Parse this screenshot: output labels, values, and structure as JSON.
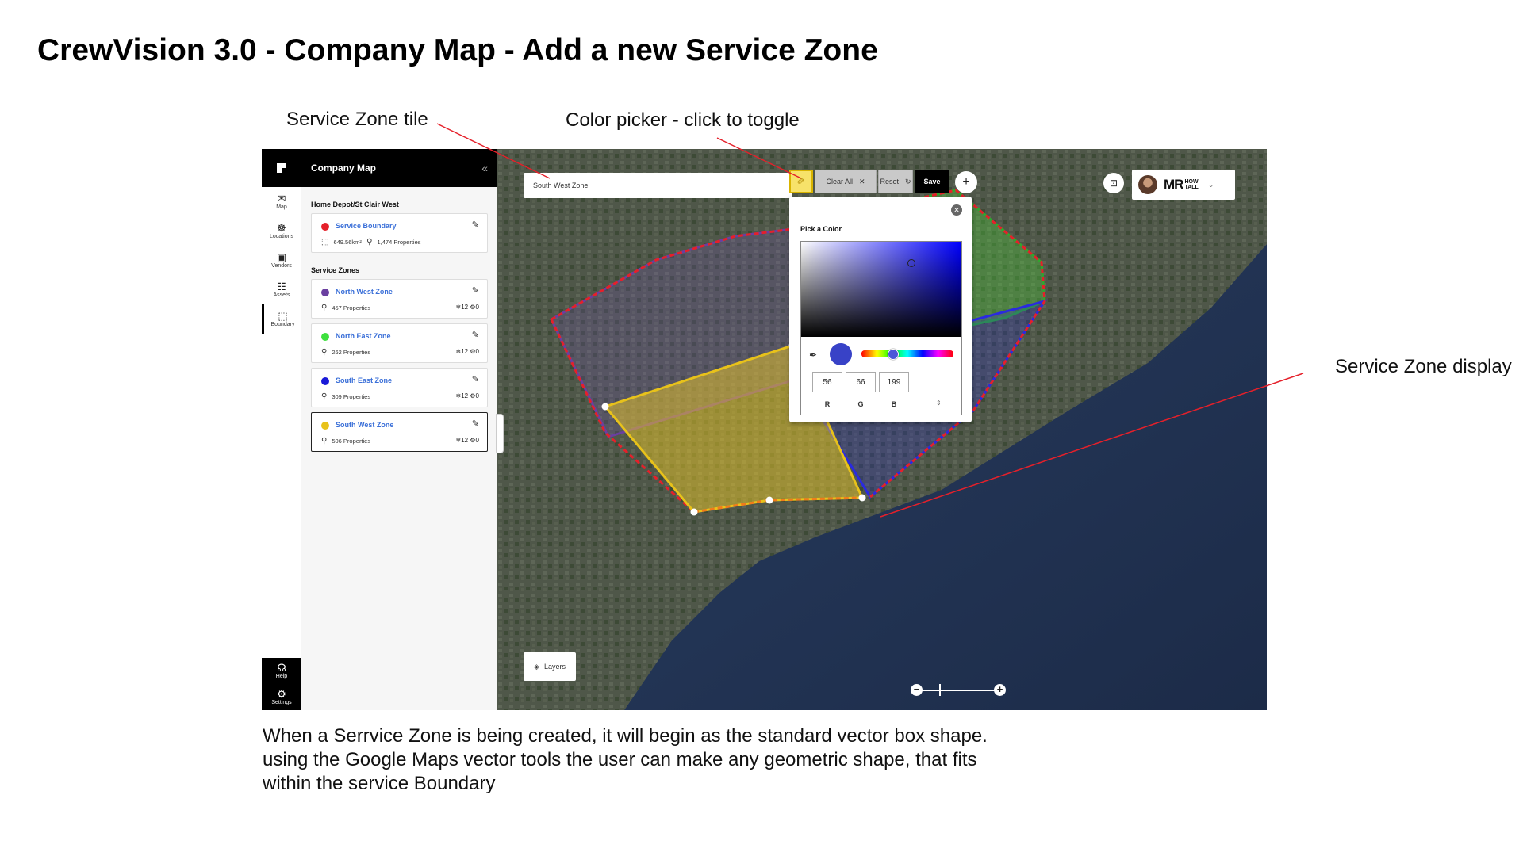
{
  "doc": {
    "title": "CrewVision 3.0 - Company Map  - Add a new Service Zone",
    "annotations": {
      "zone_tile": "Service Zone tile",
      "color_picker": "Color picker - click to toggle",
      "zone_display": "Service Zone display"
    },
    "caption": [
      "When a Serrvice Zone is being created, it will begin as the standard vector box shape.",
      "using the Google Maps vector tools the user can make any geometric shape, that fits",
      "within the service Boundary"
    ]
  },
  "rail": {
    "items": [
      {
        "label": "Map",
        "icon": "map-icon"
      },
      {
        "label": "Locations",
        "icon": "locations-icon"
      },
      {
        "label": "Vendors",
        "icon": "vendors-icon"
      },
      {
        "label": "Assets",
        "icon": "assets-icon"
      },
      {
        "label": "Boundary",
        "icon": "boundary-icon"
      }
    ],
    "help": "Help",
    "settings": "Settings"
  },
  "panel": {
    "title": "Company Map",
    "collapse_glyph": "«",
    "account": "Home Depot/St Clair West",
    "boundary": {
      "name": "Service Boundary",
      "color": "#e5202a",
      "area": "649.56km²",
      "properties": "1,474 Properties"
    },
    "zones_label": "Service Zones",
    "zones": [
      {
        "name": "North West Zone",
        "color": "#6a3fa0",
        "properties": "457 Properties",
        "count_a": "12",
        "count_b": "0"
      },
      {
        "name": "North East Zone",
        "color": "#3ee03e",
        "properties": "262 Properties",
        "count_a": "12",
        "count_b": "0"
      },
      {
        "name": "South East Zone",
        "color": "#1a1ad8",
        "properties": "309 Properties",
        "count_a": "12",
        "count_b": "0"
      },
      {
        "name": "South West Zone",
        "color": "#e8c21a",
        "properties": "506 Properties",
        "count_a": "12",
        "count_b": "0"
      }
    ]
  },
  "toolbar": {
    "zone_name": "South West Zone",
    "clear_all": "Clear All",
    "reset": "Reset",
    "save": "Save"
  },
  "picker": {
    "title": "Pick a Color",
    "r": "56",
    "g": "66",
    "b": "199",
    "r_label": "R",
    "g_label": "G",
    "b_label": "B",
    "swatch_color": "#3842c7"
  },
  "map": {
    "layers_label": "Layers"
  },
  "brand": {
    "logo": "MR",
    "sub_line1": "HOW",
    "sub_line2": "TALL"
  }
}
